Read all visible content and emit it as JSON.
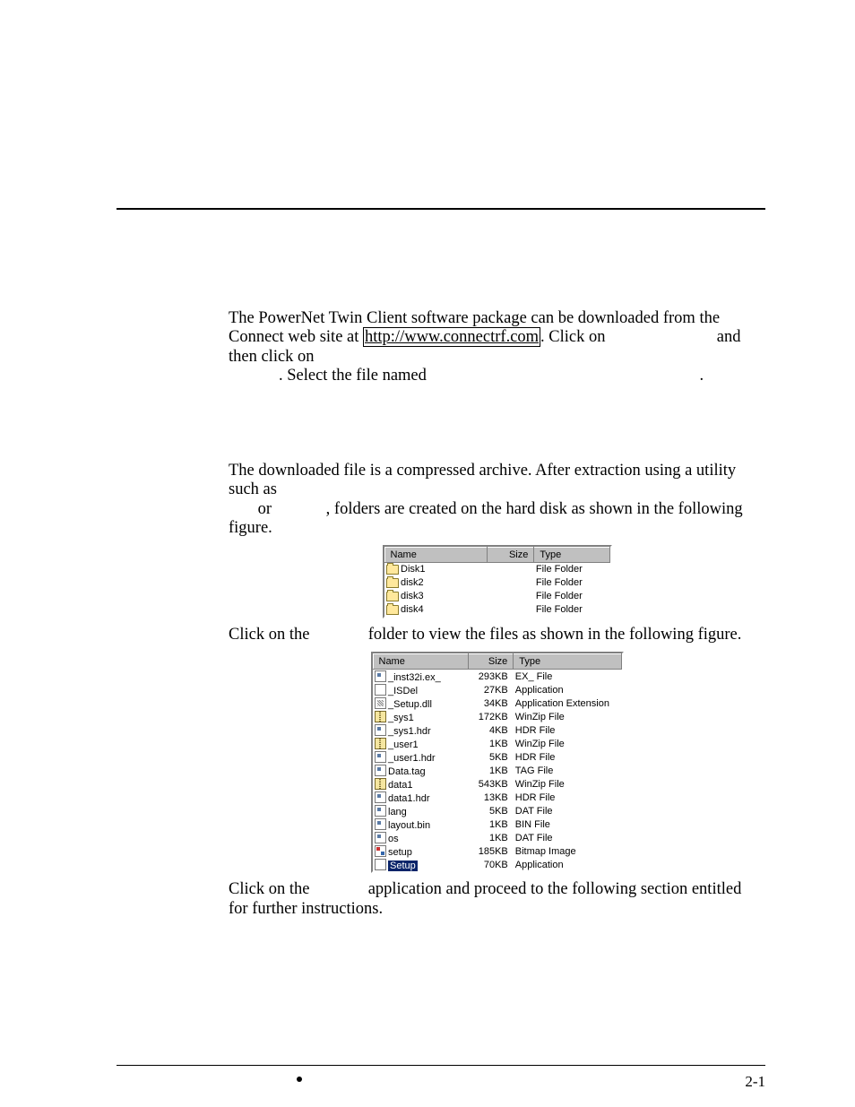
{
  "para1": {
    "seg1": "The PowerNet Twin Client software package can be downloaded from the Connect web site at ",
    "link": "http://www.connectrf.com",
    "seg2": ". Click on ",
    "seg3": " and then click on ",
    "seg4": ". Select the file named ",
    "seg5": "."
  },
  "para2": {
    "seg1": "The downloaded file is a compressed archive. After extraction using a utility such as ",
    "seg2": " or ",
    "seg3": ", folders are created on the hard disk as shown in the following figure."
  },
  "para3": {
    "seg1": "Click on the ",
    "seg2": " folder to view the files as shown in the following figure."
  },
  "para4": {
    "seg1": "Click on the ",
    "seg2": " application and proceed to the following section entitled ",
    "seg3": " for further instructions."
  },
  "fig1": {
    "headers": {
      "name": "Name",
      "size": "Size",
      "type": "Type"
    },
    "rows": [
      {
        "icon": "folder",
        "name": "Disk1",
        "size": "",
        "type": "File Folder"
      },
      {
        "icon": "folder",
        "name": "disk2",
        "size": "",
        "type": "File Folder"
      },
      {
        "icon": "folder",
        "name": "disk3",
        "size": "",
        "type": "File Folder"
      },
      {
        "icon": "folder",
        "name": "disk4",
        "size": "",
        "type": "File Folder"
      }
    ]
  },
  "fig2": {
    "headers": {
      "name": "Name",
      "size": "Size",
      "type": "Type"
    },
    "rows": [
      {
        "icon": "gen",
        "name": "_inst32i.ex_",
        "size": "293KB",
        "type": "EX_ File"
      },
      {
        "icon": "app",
        "name": "_ISDel",
        "size": "27KB",
        "type": "Application"
      },
      {
        "icon": "dll",
        "name": "_Setup.dll",
        "size": "34KB",
        "type": "Application Extension"
      },
      {
        "icon": "zip",
        "name": "_sys1",
        "size": "172KB",
        "type": "WinZip File"
      },
      {
        "icon": "gen",
        "name": "_sys1.hdr",
        "size": "4KB",
        "type": "HDR File"
      },
      {
        "icon": "zip",
        "name": "_user1",
        "size": "1KB",
        "type": "WinZip File"
      },
      {
        "icon": "gen",
        "name": "_user1.hdr",
        "size": "5KB",
        "type": "HDR File"
      },
      {
        "icon": "gen",
        "name": "Data.tag",
        "size": "1KB",
        "type": "TAG File"
      },
      {
        "icon": "zip",
        "name": "data1",
        "size": "543KB",
        "type": "WinZip File"
      },
      {
        "icon": "gen",
        "name": "data1.hdr",
        "size": "13KB",
        "type": "HDR File"
      },
      {
        "icon": "gen",
        "name": "lang",
        "size": "5KB",
        "type": "DAT File"
      },
      {
        "icon": "gen",
        "name": "layout.bin",
        "size": "1KB",
        "type": "BIN File"
      },
      {
        "icon": "gen",
        "name": "os",
        "size": "1KB",
        "type": "DAT File"
      },
      {
        "icon": "bmp",
        "name": "setup",
        "size": "185KB",
        "type": "Bitmap Image"
      },
      {
        "icon": "app",
        "name": "Setup",
        "size": "70KB",
        "type": "Application",
        "selected": true
      }
    ]
  },
  "footer": {
    "pagenum": "2-1"
  }
}
